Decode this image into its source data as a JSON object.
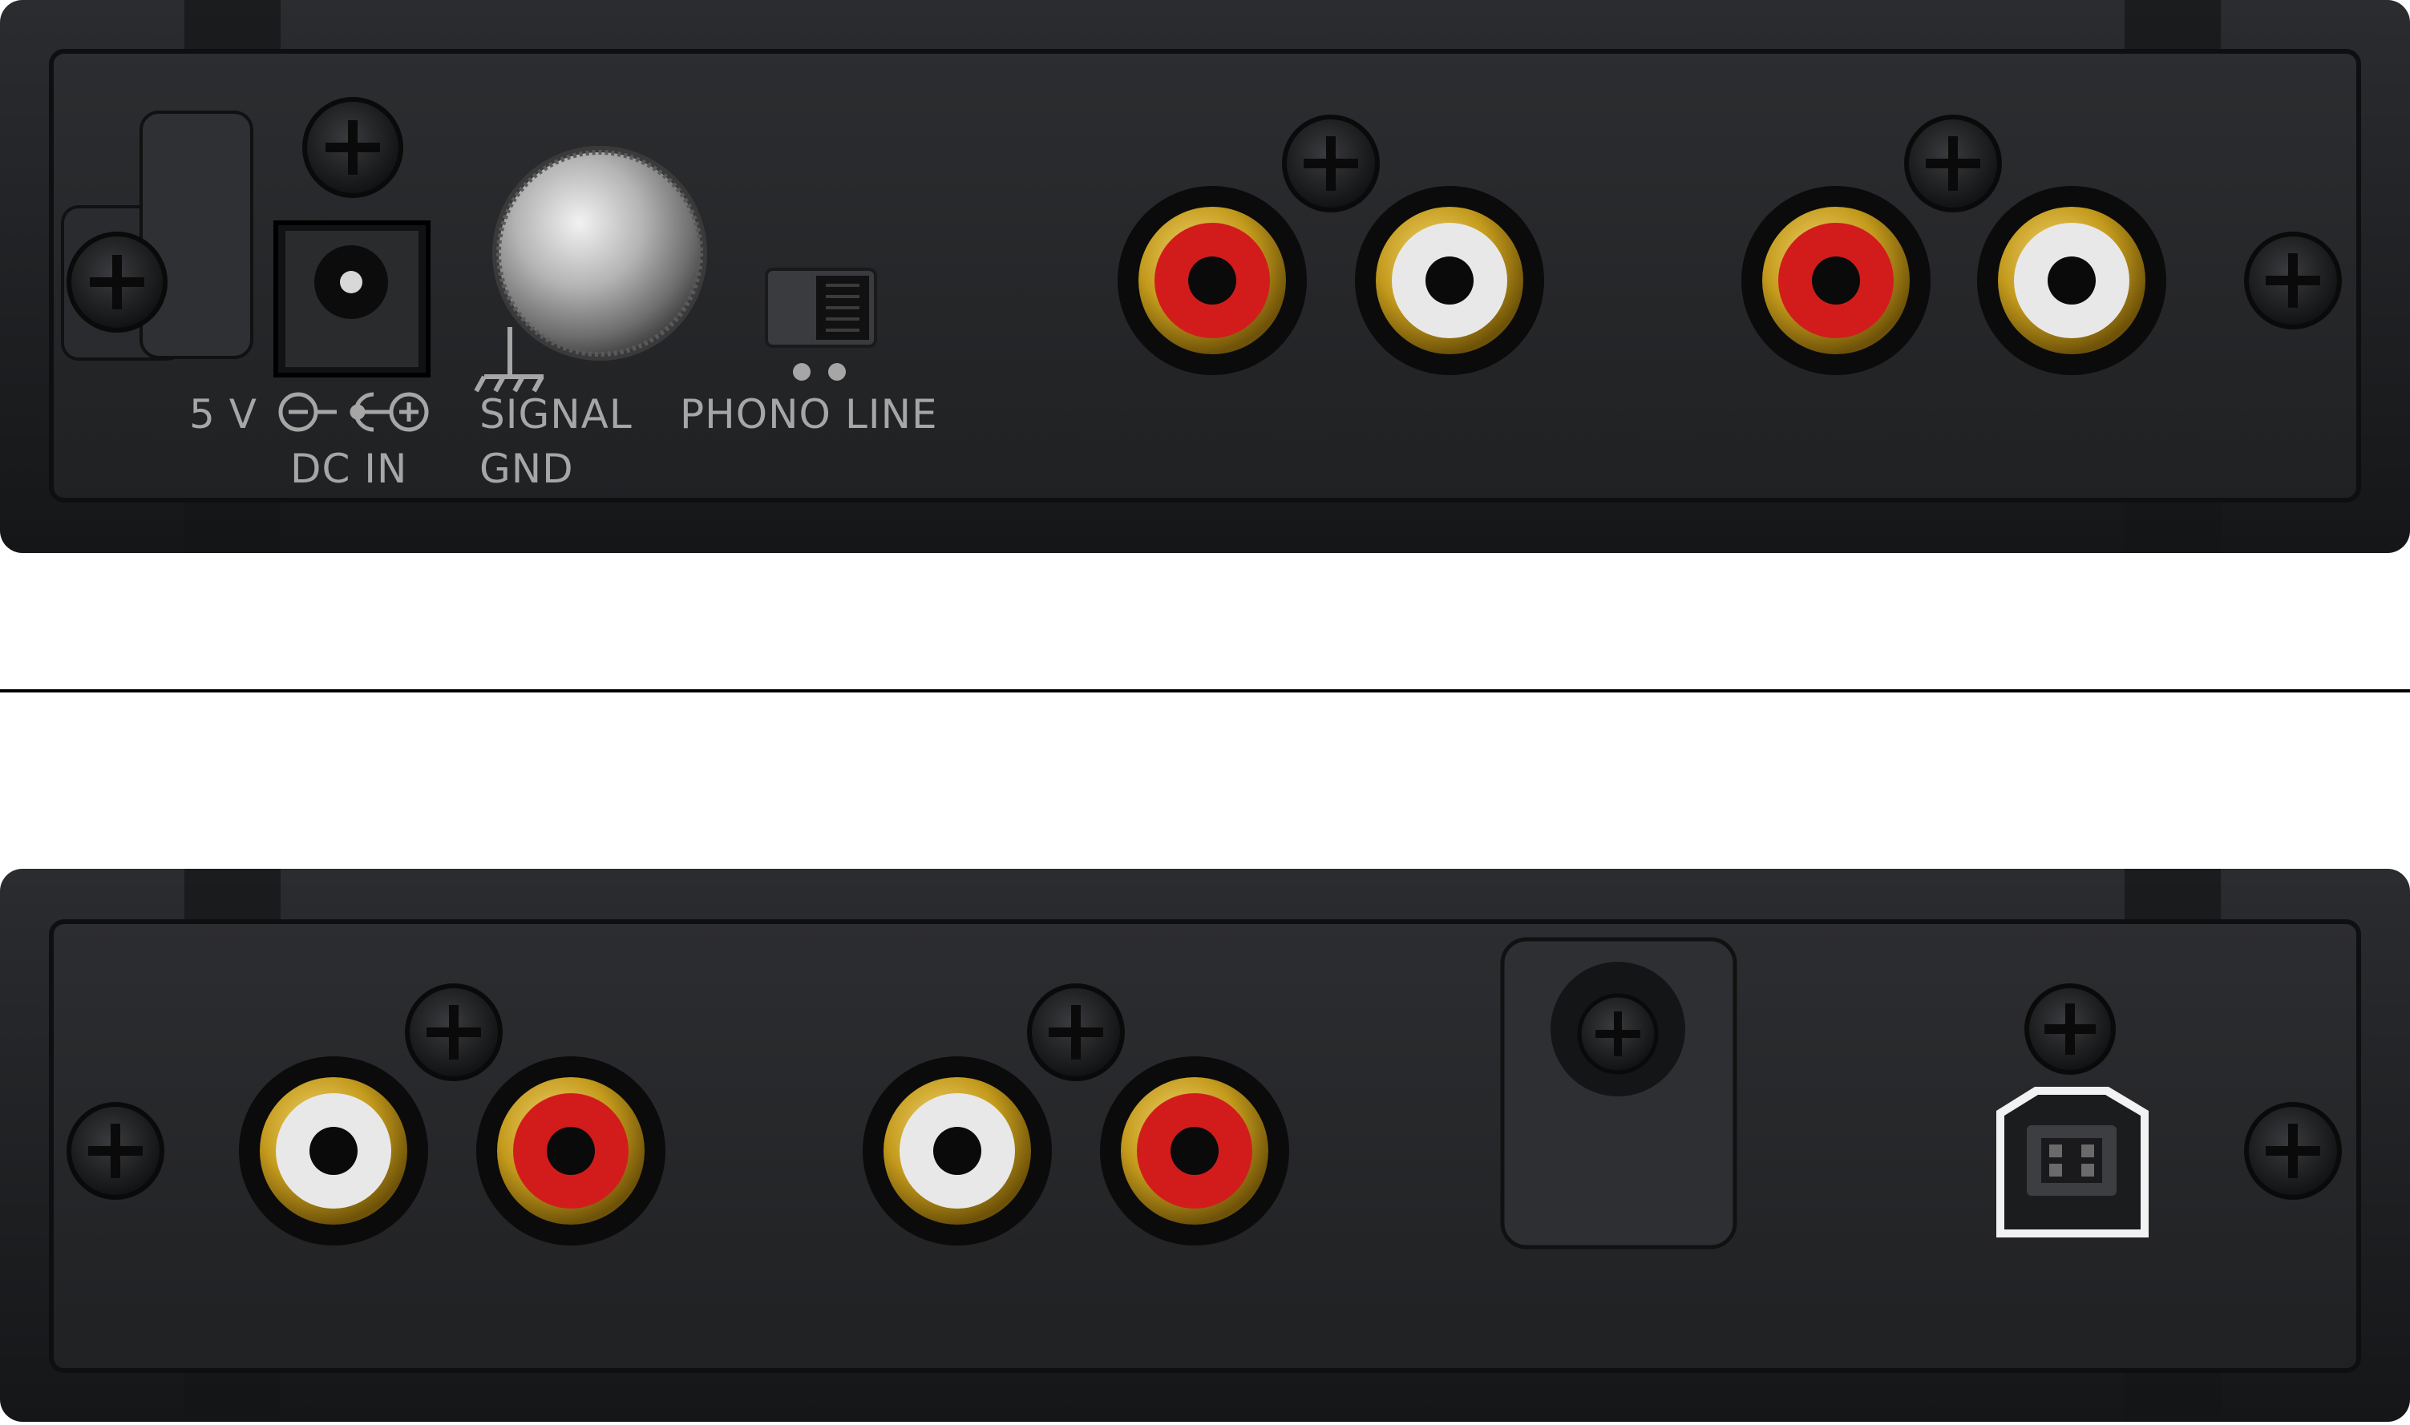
{
  "colors": {
    "background": "#ffffff",
    "panel": "#1e1f21",
    "panel_face": "#262729",
    "label": "#a6a6a6",
    "rca_red": "#d21c1c",
    "rca_white": "#e8e8e8",
    "rca_gold": "#c8a020",
    "divider": "#000000"
  },
  "top_panel": {
    "power_label": "5 V",
    "dc_in_label": "DC IN",
    "signal_label": "SIGNAL",
    "gnd_label": "GND",
    "phono_label": "PHONO",
    "line_label": "LINE"
  },
  "icons": [
    "dc-polarity-icon",
    "ground-icon",
    "usb-b-port-icon",
    "screw-icon"
  ]
}
